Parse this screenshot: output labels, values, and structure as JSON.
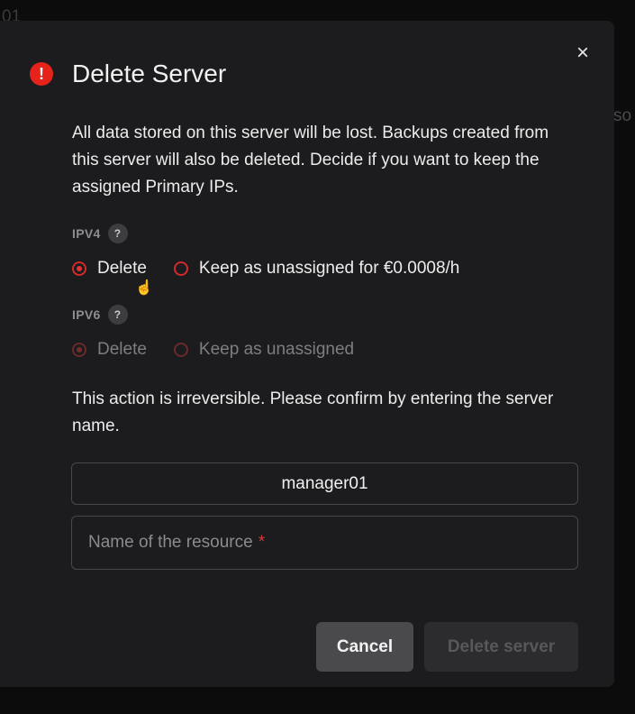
{
  "background": {
    "top_text": "01",
    "right_text": "so"
  },
  "dialog": {
    "title": "Delete Server",
    "alert_icon": "!",
    "close_icon": "×",
    "description": "All data stored on this server will be lost. Backups created from this server will also be deleted. Decide if you want to keep the assigned Primary IPs.",
    "ipv4": {
      "label": "IPV4",
      "help": "?",
      "options": [
        "Delete",
        "Keep as unassigned for €0.0008/h"
      ],
      "selected": "Delete"
    },
    "ipv6": {
      "label": "IPV6",
      "help": "?",
      "options": [
        "Delete",
        "Keep as unassigned"
      ],
      "selected": "Delete",
      "disabled": true
    },
    "confirm_text": "This action is irreversible. Please confirm by entering the server name.",
    "server_name": "manager01",
    "input": {
      "placeholder": "Name of the resource",
      "required_mark": "*",
      "value": ""
    },
    "buttons": {
      "cancel": "Cancel",
      "delete": "Delete server"
    }
  },
  "colors": {
    "accent": "#e23434",
    "alert": "#e5231b",
    "modal_bg": "#1c1c1e"
  }
}
